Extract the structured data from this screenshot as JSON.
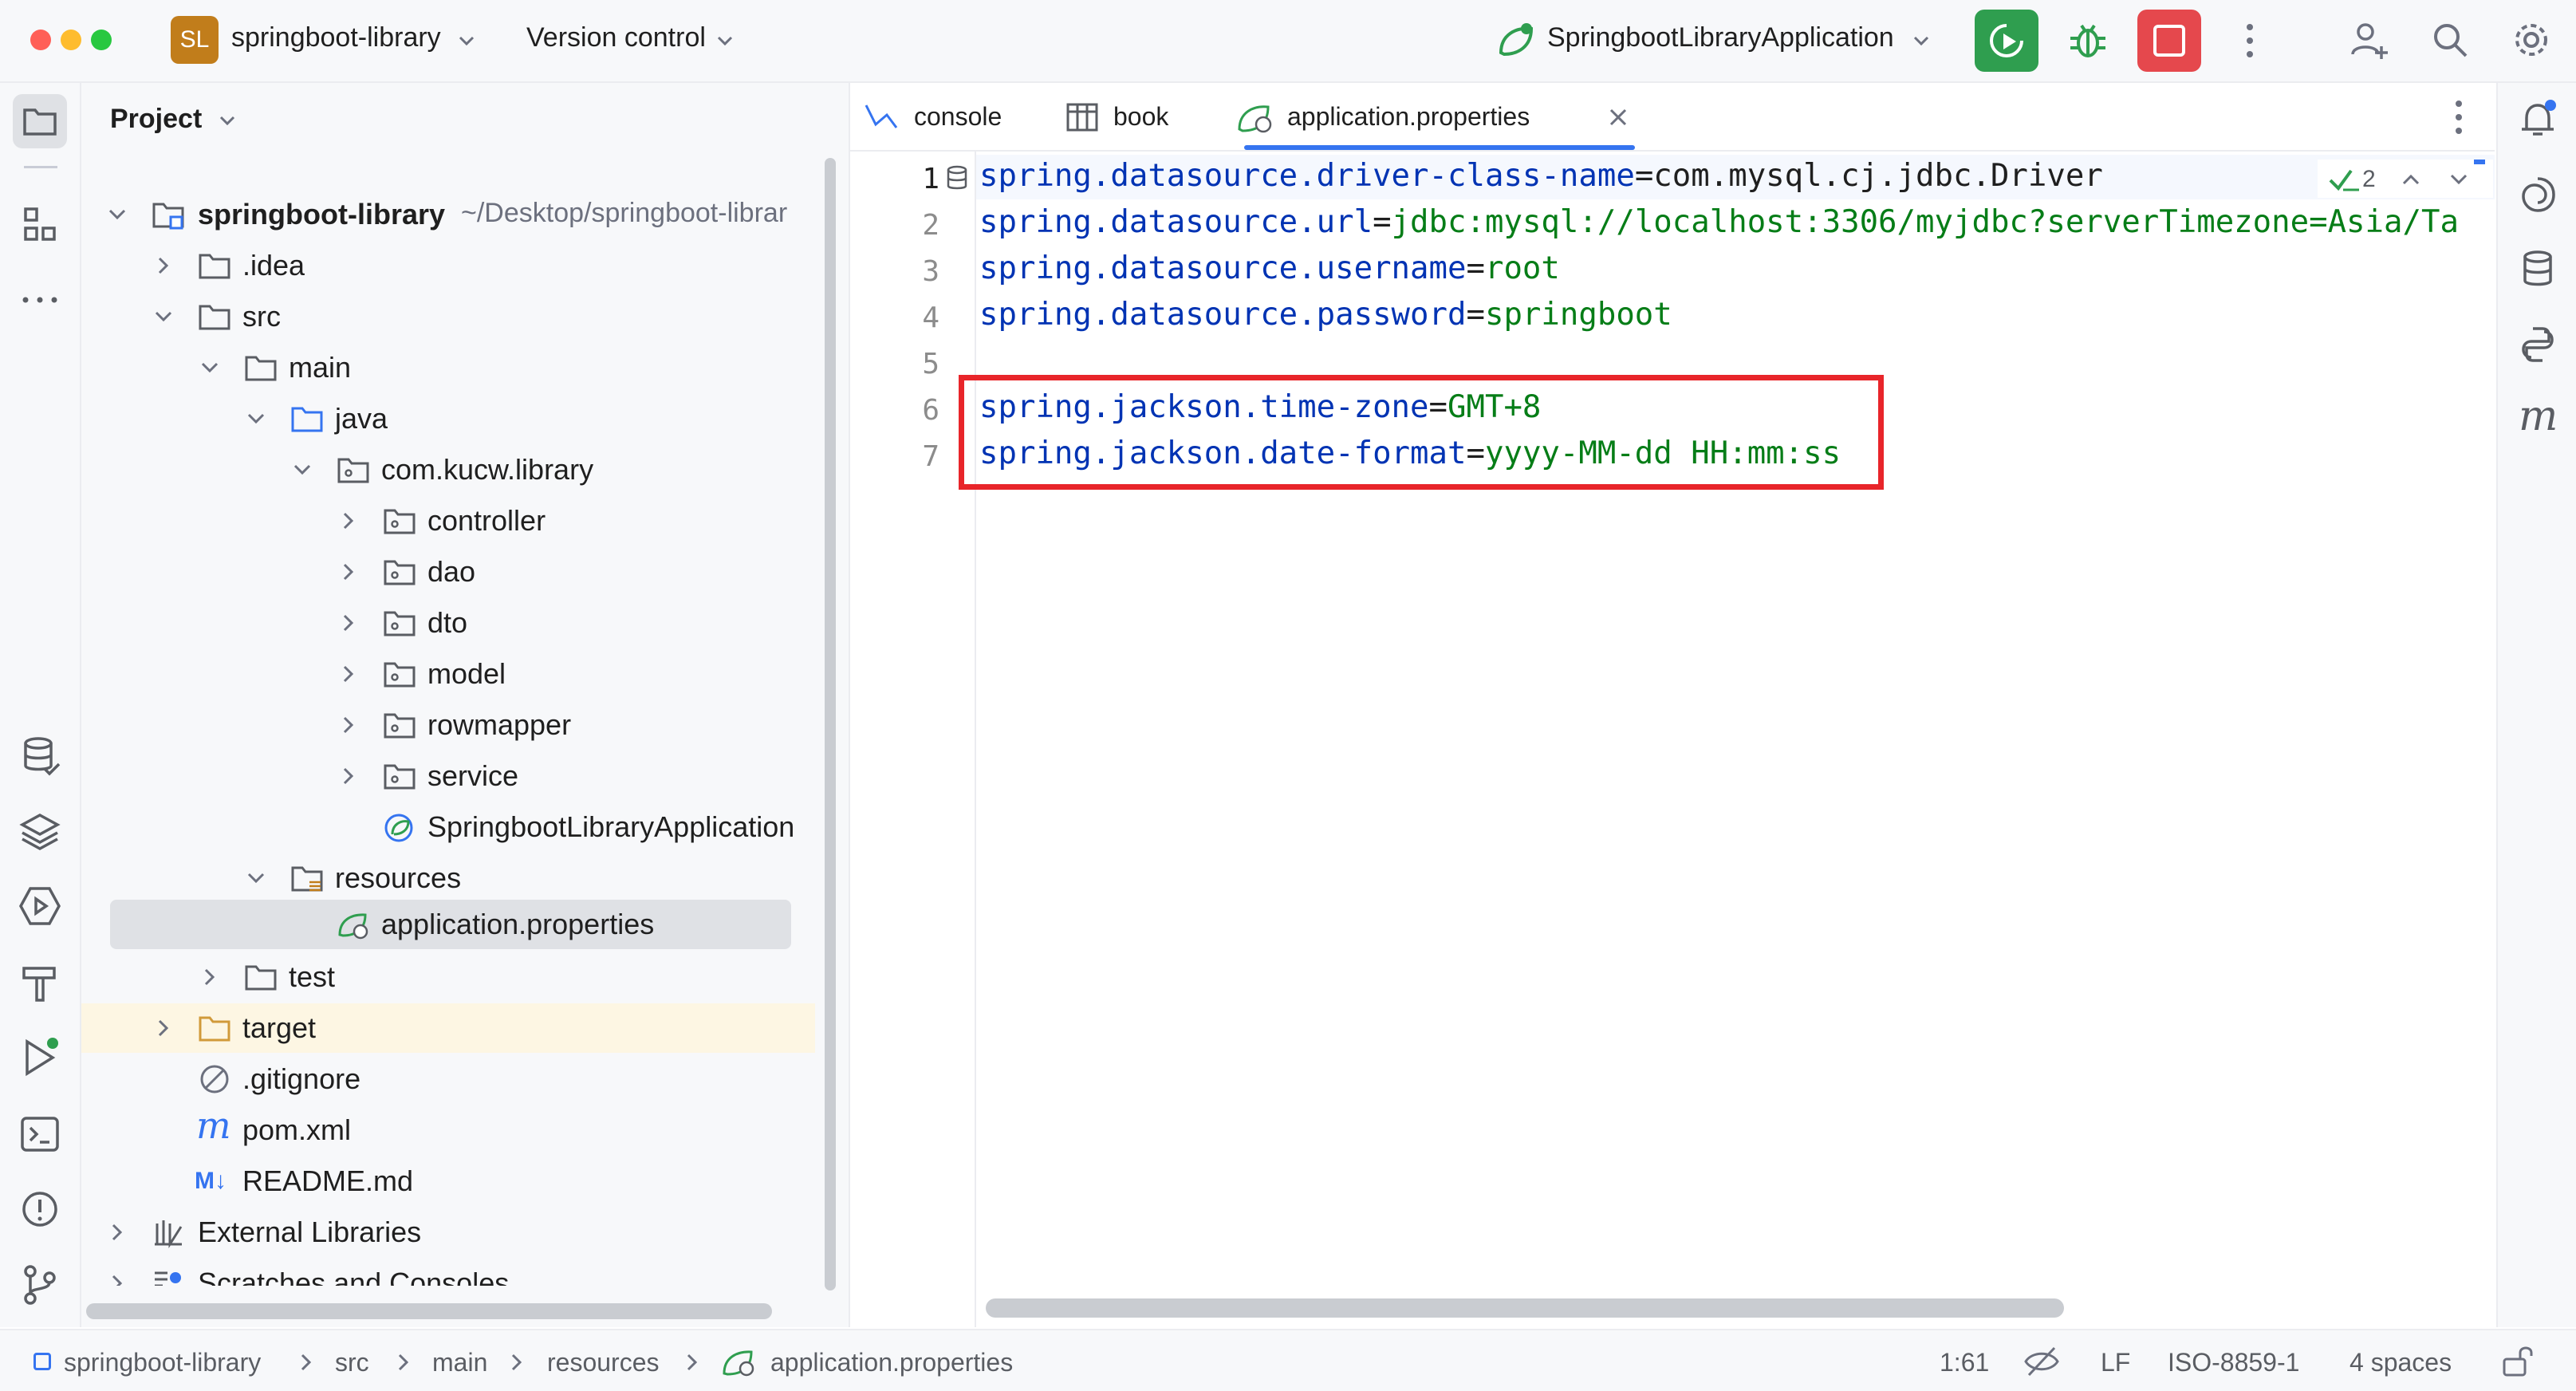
{
  "titlebar": {
    "project_badge": "SL",
    "project_name": "springboot-library",
    "version_control": "Version control",
    "run_config": "SpringbootLibraryApplication"
  },
  "project_panel": {
    "title": "Project",
    "root_name": "springboot-library",
    "root_path": "~/Desktop/springboot-librar",
    "items": [
      {
        "label": "springboot-library"
      },
      {
        "label": ".idea"
      },
      {
        "label": "src"
      },
      {
        "label": "main"
      },
      {
        "label": "java"
      },
      {
        "label": "com.kucw.library"
      },
      {
        "label": "controller"
      },
      {
        "label": "dao"
      },
      {
        "label": "dto"
      },
      {
        "label": "model"
      },
      {
        "label": "rowmapper"
      },
      {
        "label": "service"
      },
      {
        "label": "SpringbootLibraryApplication"
      },
      {
        "label": "resources"
      },
      {
        "label": "application.properties"
      },
      {
        "label": "test"
      },
      {
        "label": "target"
      },
      {
        "label": ".gitignore"
      },
      {
        "label": "pom.xml"
      },
      {
        "label": "README.md"
      },
      {
        "label": "External Libraries"
      },
      {
        "label": "Scratches and Consoles"
      }
    ]
  },
  "tabs": [
    {
      "label": "console"
    },
    {
      "label": "book"
    },
    {
      "label": "application.properties"
    }
  ],
  "editor": {
    "inspection_count": "2",
    "lines": [
      {
        "num": "1",
        "key": "spring.datasource.driver-class-name",
        "eq": "=",
        "val": "com.mysql.cj.jdbc.Driver"
      },
      {
        "num": "2",
        "key": "spring.datasource.url",
        "eq": "=",
        "val": "jdbc:mysql://localhost:3306/myjdbc?serverTimezone=Asia/Ta"
      },
      {
        "num": "3",
        "key": "spring.datasource.username",
        "eq": "=",
        "val": "root"
      },
      {
        "num": "4",
        "key": "spring.datasource.password",
        "eq": "=",
        "val": "springboot"
      },
      {
        "num": "5",
        "key": "",
        "eq": "",
        "val": ""
      },
      {
        "num": "6",
        "key": "spring.jackson.time-zone",
        "eq": "=",
        "val": "GMT+8"
      },
      {
        "num": "7",
        "key": "spring.jackson.date-format",
        "eq": "=",
        "val": "yyyy-MM-dd HH:mm:ss"
      }
    ]
  },
  "status": {
    "breadcrumb": [
      "springboot-library",
      "src",
      "main",
      "resources",
      "application.properties"
    ],
    "cursor": "1:61",
    "line_sep": "LF",
    "encoding": "ISO-8859-1",
    "indent": "4 spaces"
  },
  "colors": {
    "accent": "#3574f0",
    "highlight": "#e8252a",
    "run_green": "#2f9e4f",
    "stop_red": "#e5484d",
    "key_blue": "#0033b3",
    "value_green": "#067d17"
  }
}
